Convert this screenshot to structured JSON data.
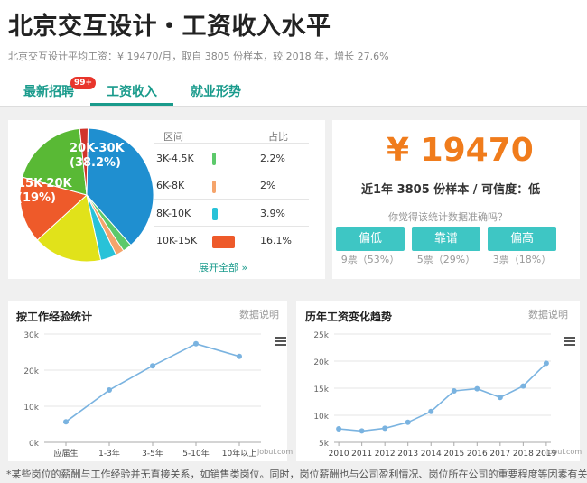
{
  "header": {
    "title": "北京交互设计・工资收入水平",
    "subtitle": "北京交互设计平均工资：¥ 19470/月，取自 3805 份样本，较 2018 年，增长 27.6%"
  },
  "tabs": [
    {
      "label": "最新招聘",
      "badge": "99+"
    },
    {
      "label": "工资收入",
      "active": true
    },
    {
      "label": "就业形势"
    }
  ],
  "distribution": {
    "col_range": "区间",
    "col_share": "占比",
    "rows": [
      {
        "range": "3K-4.5K",
        "share": "2.2%",
        "color": "#5cc96a"
      },
      {
        "range": "6K-8K",
        "share": "2%",
        "color": "#f5a46b"
      },
      {
        "range": "8K-10K",
        "share": "3.9%",
        "color": "#28c2d8"
      },
      {
        "range": "10K-15K",
        "share": "16.1%",
        "color": "#ee5a2a"
      }
    ],
    "more_link": "展开全部 »",
    "pie_labels": [
      {
        "line1": "20K-30K",
        "line2": "(38.2%)"
      },
      {
        "line1": "15K-20K",
        "line2": "(19%)"
      }
    ],
    "pie_slices": [
      {
        "label": "20K-30K",
        "share": 38.2,
        "color": "#1f8fd0"
      },
      {
        "label": "3K-4.5K",
        "share": 2.2,
        "color": "#5cc96a"
      },
      {
        "label": "6K-8K",
        "share": 2.0,
        "color": "#f5a46b"
      },
      {
        "label": "8K-10K",
        "share": 3.9,
        "color": "#28c2d8"
      },
      {
        "label": "other",
        "share": 16.6,
        "color": "#e1e21a"
      },
      {
        "label": "10K-15K",
        "share": 16.1,
        "color": "#ee5a2a"
      },
      {
        "label": "15K-20K",
        "share": 19.0,
        "color": "#59b935"
      },
      {
        "label": "other2",
        "share": 2.0,
        "color": "#d0342b"
      }
    ]
  },
  "summary": {
    "salary": "¥ 19470",
    "sample_text": "近1年 3805 份样本 / 可信度：低",
    "question": "你觉得该统计数据准确吗？",
    "votes": [
      {
        "label": "偏低",
        "count": "9票（53%）"
      },
      {
        "label": "靠谱",
        "count": "5票（29%）"
      },
      {
        "label": "偏高",
        "count": "3票（18%）"
      }
    ]
  },
  "experience_chart": {
    "title": "按工作经验统计",
    "note": "数据说明",
    "credit": "jobui.com"
  },
  "trend_chart": {
    "title": "历年工资变化趋势",
    "note": "数据说明",
    "credit": "jobui.com"
  },
  "chart_data": [
    {
      "type": "line",
      "categories": [
        "应届生",
        "1-3年",
        "3-5年",
        "5-10年",
        "10年以上"
      ],
      "values": [
        5700,
        14500,
        21200,
        27300,
        23800
      ],
      "yticks": [
        "0k",
        "10k",
        "20k",
        "30k"
      ],
      "ylim": [
        0,
        30000
      ],
      "title": "按工作经验统计"
    },
    {
      "type": "line",
      "categories": [
        "2010",
        "2011",
        "2012",
        "2013",
        "2014",
        "2015",
        "2016",
        "2017",
        "2018",
        "2019"
      ],
      "values": [
        7500,
        7100,
        7600,
        8700,
        10700,
        14500,
        14900,
        13300,
        15400,
        19600
      ],
      "yticks": [
        "5k",
        "10k",
        "15k",
        "20k",
        "25k"
      ],
      "ylim": [
        5000,
        25000
      ],
      "title": "历年工资变化趋势"
    }
  ],
  "footer": {
    "text": "*某些岗位的薪酬与工作经验并无直接关系，如销售类岗位。同时，岗位薪酬也与公司盈利情况、岗位所在公司的重要程度等因素有关。"
  },
  "colors": {
    "accent": "#1a9b8c",
    "salary": "#f07c1c",
    "button": "#3ec6c4",
    "line": "#7ab3e0"
  }
}
